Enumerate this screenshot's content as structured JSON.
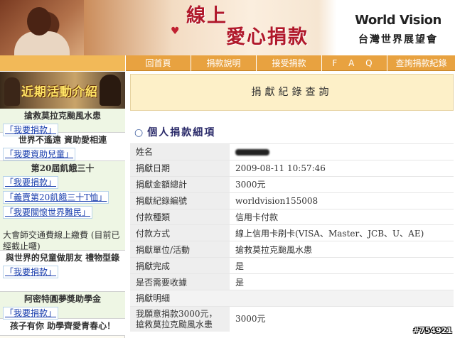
{
  "banner": {
    "title_line1": "線上",
    "title_line2": "愛心捐款",
    "logo_en": "World Vision",
    "logo_zh": "台灣世界展望會"
  },
  "nav": {
    "items": [
      "回首頁",
      "捐款說明",
      "接受捐款",
      "F A Q",
      "查詢捐款紀錄"
    ]
  },
  "sidebar": {
    "header": "近期活動介紹",
    "blocks": [
      {
        "title": "搶救莫拉克颱風水患",
        "links": [
          "「我要捐款」"
        ]
      },
      {
        "title": "世界不遙遠 資助愛相連",
        "links": [
          "「我要資助兒童」"
        ]
      },
      {
        "title": "第20屆飢餓三十",
        "links": [
          "「我要捐款」",
          "「義賣第20飢餓三十T恤」",
          "「我要關懷世界難民」"
        ],
        "note": "大會師交通費線上繳費 (目前已經截止囉)"
      },
      {
        "title": "與世界的兒童做朋友 禮物型錄",
        "links": [
          "「我要捐款」"
        ]
      },
      {
        "title": "阿密特圓夢獎助學金",
        "links": [
          "「我要捐款」"
        ]
      },
      {
        "title": "孩子有你 助學齊愛青春心！",
        "links": []
      }
    ]
  },
  "main": {
    "title": "捐獻紀錄查詢",
    "section_title": "個人捐款細項",
    "rows": [
      {
        "label": "姓名",
        "value": ""
      },
      {
        "label": "捐獻日期",
        "value": "2009-08-11 10:57:46"
      },
      {
        "label": "捐獻金額總計",
        "value": "3000元"
      },
      {
        "label": "捐獻紀錄編號",
        "value": "worldvision155008"
      },
      {
        "label": "付款種類",
        "value": "信用卡付款"
      },
      {
        "label": "付款方式",
        "value": "線上信用卡刷卡(VISA、Master、JCB、U、AE)"
      },
      {
        "label": "捐獻單位/活動",
        "value": "搶救莫拉克颱風水患"
      },
      {
        "label": "捐獻完成",
        "value": "是"
      },
      {
        "label": "是否需要收據",
        "value": "是"
      }
    ],
    "detail_header": "捐獻明細",
    "detail_row": {
      "label": "我願意捐款3000元，搶救莫拉克颱風水患",
      "value": "3000元"
    }
  },
  "watermark": "#754921"
}
